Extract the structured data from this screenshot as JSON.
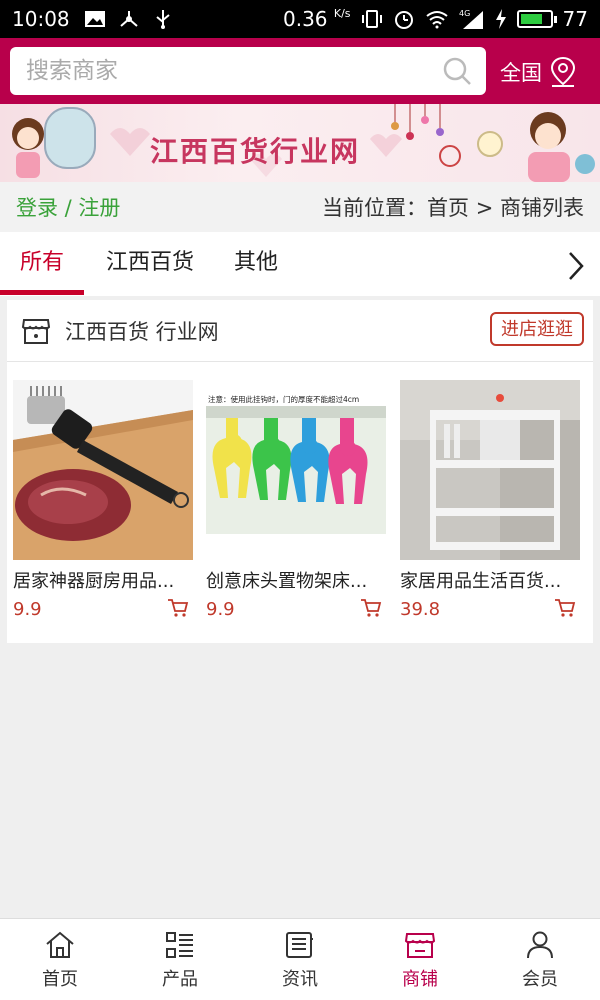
{
  "status": {
    "time": "10:08",
    "speed": "0.36",
    "speed_unit": "K/s",
    "battery": "77",
    "battery_level": 0.77,
    "network": "4G"
  },
  "header": {
    "search_placeholder": "搜索商家",
    "region": "全国"
  },
  "banner": {
    "title": "江西百货行业网"
  },
  "location": {
    "login": "登录 / 注册",
    "breadcrumb": "当前位置：首页 > 商铺列表"
  },
  "tabs": [
    {
      "label": "所有",
      "active": true
    },
    {
      "label": "江西百货",
      "active": false
    },
    {
      "label": "其他",
      "active": false
    }
  ],
  "shop": {
    "name": "江西百货 行业网",
    "enter_label": "进店逛逛",
    "products": [
      {
        "name": "居家神器厨房用品...",
        "price": "9.9",
        "image": "meat-tenderizer"
      },
      {
        "name": "创意床头置物架床...",
        "price": "9.9",
        "image": "door-hooks",
        "image_caption": "注意：使用此挂钩时，门的厚度不能超过4cm"
      },
      {
        "name": "家居用品生活百货...",
        "price": "39.8",
        "image": "kitchen-rack"
      }
    ]
  },
  "bottom_nav": [
    {
      "label": "首页",
      "icon": "home-icon",
      "active": false
    },
    {
      "label": "产品",
      "icon": "list-icon",
      "active": false
    },
    {
      "label": "资讯",
      "icon": "news-icon",
      "active": false
    },
    {
      "label": "商铺",
      "icon": "shop-icon",
      "active": true
    },
    {
      "label": "会员",
      "icon": "user-icon",
      "active": false
    }
  ],
  "colors": {
    "brand": "#b8004b",
    "accent_red": "#c8002a",
    "login_green": "#3aa23a",
    "price_red": "#c0392b"
  }
}
